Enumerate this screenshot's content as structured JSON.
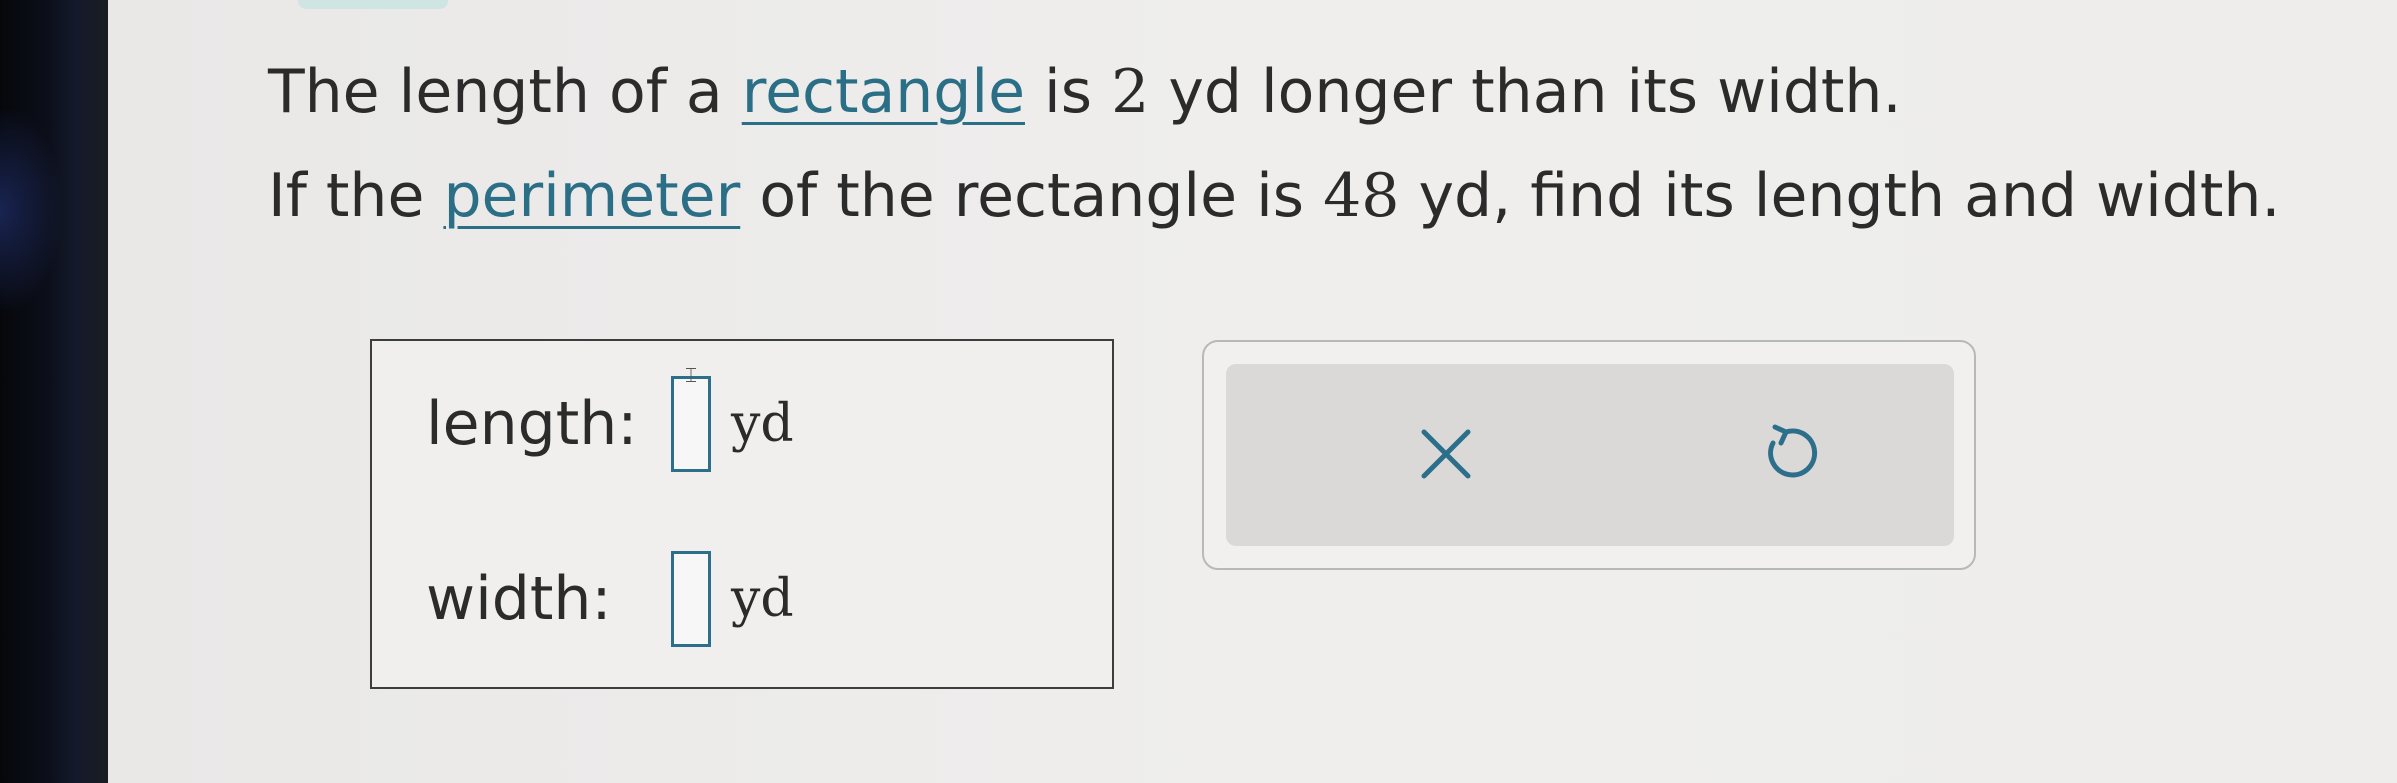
{
  "question": {
    "line1": {
      "before": "The length of a ",
      "term": "rectangle",
      "after_text": " is ",
      "num": "2",
      "after_num": " yd longer than its width."
    },
    "line2": {
      "before": "If the ",
      "term": "perimeter",
      "after_text": " of the rectangle is ",
      "num": "48",
      "after_num": " yd, find its length and width."
    }
  },
  "answers": {
    "length": {
      "label": "length:",
      "value": "",
      "unit": "yd"
    },
    "width": {
      "label": "width:",
      "value": "",
      "unit": "yd"
    }
  },
  "tools": {
    "clear_icon": "x-icon",
    "undo_icon": "undo-icon"
  },
  "colors": {
    "accent": "#2b6f86",
    "border": "#3d3d3d",
    "tools_bg": "#dad9d8"
  }
}
